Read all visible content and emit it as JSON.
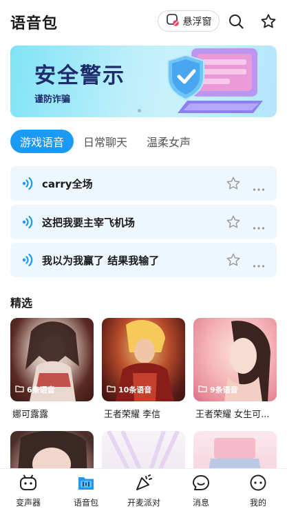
{
  "header": {
    "title": "语音包",
    "float_window_label": "悬浮窗",
    "icons": [
      "float-window-icon",
      "search-icon",
      "star-icon"
    ]
  },
  "banner": {
    "title": "安全警示",
    "subtitle": "谨防诈骗",
    "pager": {
      "count": 2,
      "active": 0
    }
  },
  "tabs": [
    {
      "label": "游戏语音",
      "active": true
    },
    {
      "label": "日常聊天",
      "active": false
    },
    {
      "label": "温柔女声",
      "active": false
    }
  ],
  "voices": [
    {
      "text": "carry全场"
    },
    {
      "text": "这把我要主宰飞机场"
    },
    {
      "text": "我以为我赢了 结果我输了"
    }
  ],
  "featured": {
    "title": "精选",
    "cards": [
      {
        "badge": "6条语音",
        "caption": "娜可露露"
      },
      {
        "badge": "10条语音",
        "caption": "王者荣耀 李信"
      },
      {
        "badge": "9条语音",
        "caption": "王者荣耀 女生可..."
      },
      {
        "badge": "",
        "caption": ""
      },
      {
        "badge": "",
        "caption": ""
      },
      {
        "badge": "",
        "caption": ""
      }
    ]
  },
  "bottom_nav": [
    {
      "label": "变声器",
      "icon": "voice-changer-icon"
    },
    {
      "label": "语音包",
      "icon": "voice-pack-icon",
      "active": true
    },
    {
      "label": "开麦派对",
      "icon": "party-icon"
    },
    {
      "label": "消息",
      "icon": "message-icon"
    },
    {
      "label": "我的",
      "icon": "profile-icon"
    }
  ],
  "colors": {
    "accent": "#1a9af5",
    "row_bg": "#eef6fe",
    "banner_text": "#1d2a6b"
  }
}
